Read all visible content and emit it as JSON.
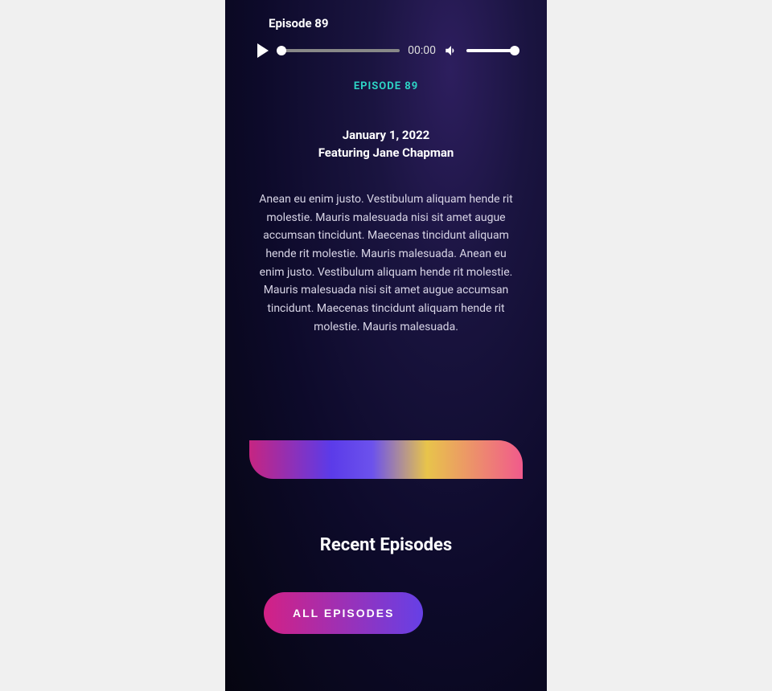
{
  "player": {
    "title": "Episode 89",
    "time": "00:00"
  },
  "episode": {
    "label": "Episode 89",
    "date": "January 1, 2022",
    "featuring": "Featuring Jane Chapman",
    "description": "Anean eu enim justo. Vestibulum aliquam hende rit molestie. Mauris malesuada nisi sit amet augue accumsan tincidunt. Maecenas tincidunt aliquam hende rit molestie. Mauris malesuada. Anean eu enim justo. Vestibulum aliquam hende rit molestie. Mauris malesuada nisi sit amet augue accumsan tincidunt. Maecenas tincidunt aliquam hende rit molestie. Mauris malesuada."
  },
  "recent": {
    "heading": "Recent Episodes",
    "button": "All Episodes"
  }
}
